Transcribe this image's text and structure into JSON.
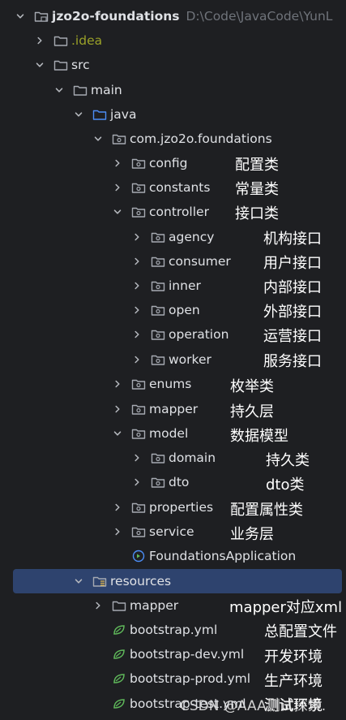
{
  "project": {
    "name": "jzo2o-foundations",
    "path": "D:\\Code\\JavaCode\\YunL"
  },
  "tree": {
    "idea": ".idea",
    "src": "src",
    "main": "main",
    "java": "java",
    "package": "com.jzo2o.foundations",
    "config": "config",
    "constants": "constants",
    "controller": "controller",
    "agency": "agency",
    "consumer": "consumer",
    "inner": "inner",
    "open": "open",
    "operation": "operation",
    "worker": "worker",
    "enums": "enums",
    "mapper": "mapper",
    "model": "model",
    "domain": "domain",
    "dto": "dto",
    "properties": "properties",
    "service": "service",
    "app": "FoundationsApplication",
    "resources": "resources",
    "res_mapper": "mapper",
    "bootstrap": "bootstrap.yml",
    "bootstrap_dev": "bootstrap-dev.yml",
    "bootstrap_prod": "bootstrap-prod.yml",
    "bootstrap_test": "bootstrap-test.yml"
  },
  "notes": {
    "config": "配置类",
    "constants": "常量类",
    "controller": "接口类",
    "agency": "机构接口",
    "consumer": "用户接口",
    "inner": "内部接口",
    "open": "外部接口",
    "operation": "运营接口",
    "worker": "服务接口",
    "enums": "枚举类",
    "mapper": "持久层",
    "model": "数据模型",
    "domain": "持久类",
    "dto": "dto类",
    "properties": "配置属性类",
    "service": "业务层",
    "res_mapper": "mapper对应xml",
    "bootstrap": "总配置文件",
    "bootstrap_dev": "开发环境",
    "bootstrap_prod": "生产环境",
    "bootstrap_test": "测试环境"
  },
  "watermark": "CSDN @AAA测试探索.",
  "colors": {
    "background": "#1e1f22",
    "selection": "#2e436e",
    "folder_icon": "#a6aab2",
    "source_folder_icon": "#4c8df6",
    "spring_icon": "#5fb85a",
    "idea_text": "#9aa128",
    "path_text": "#6f737a"
  }
}
